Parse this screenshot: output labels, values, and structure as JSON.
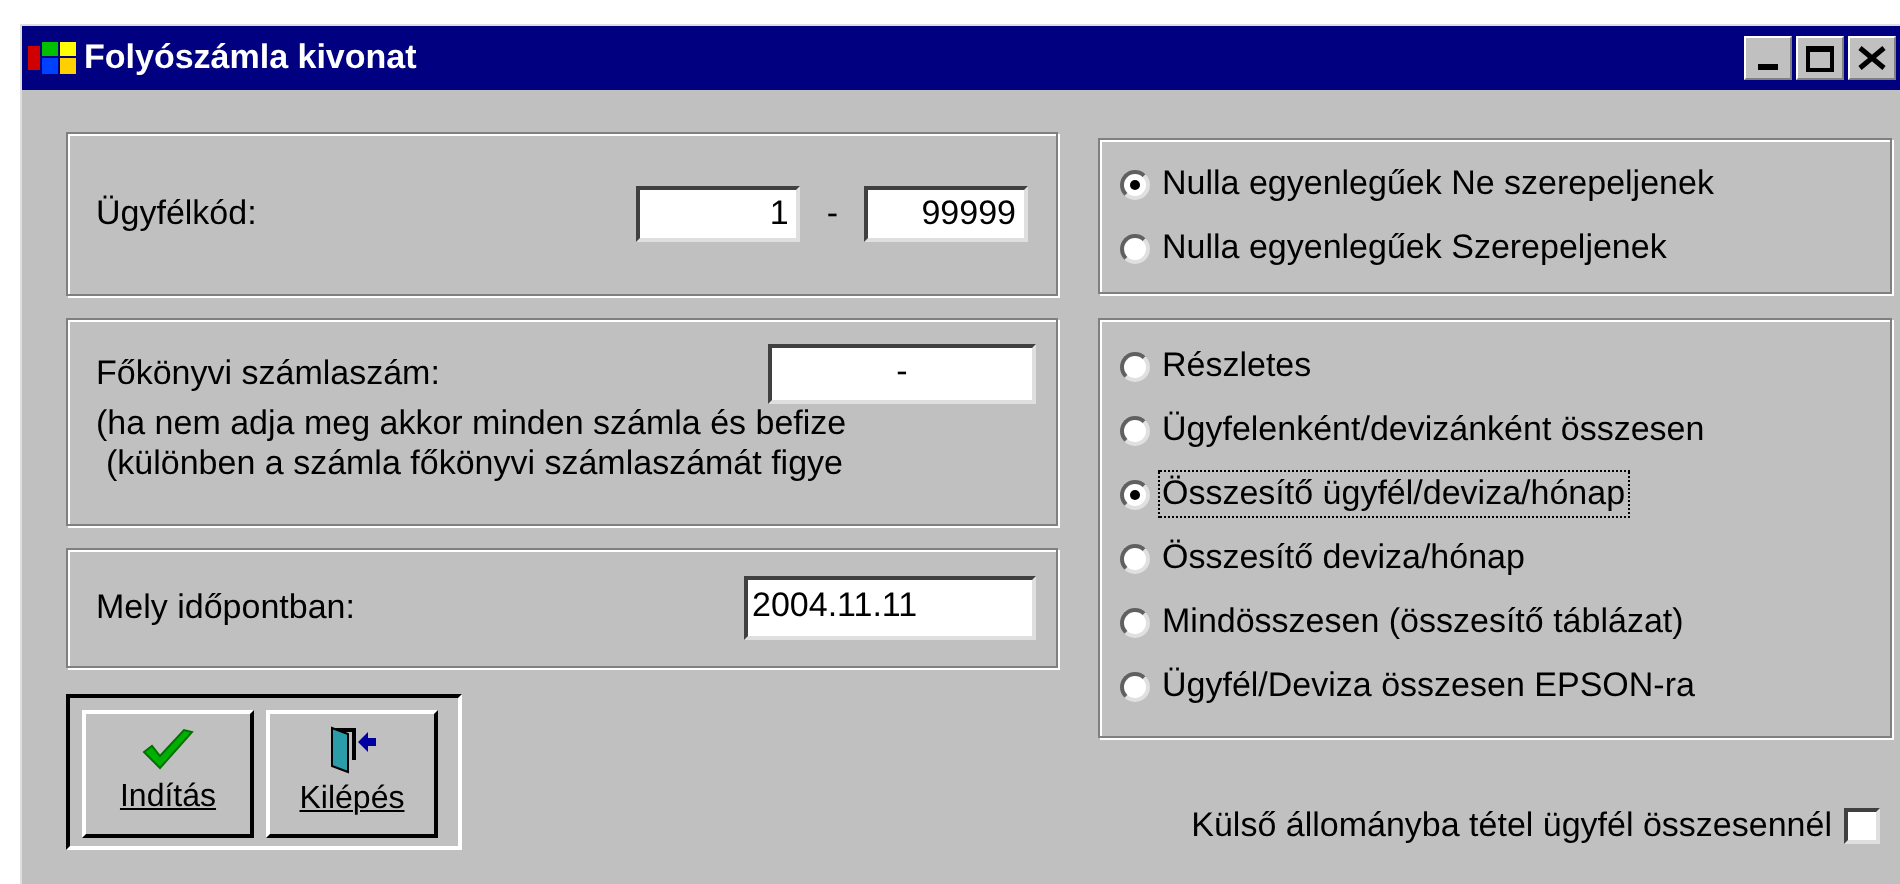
{
  "window": {
    "title": "Folyószámla kivonat"
  },
  "client_code": {
    "label": "Ügyfélkód:",
    "from": "1",
    "separator": "-",
    "to": "99999"
  },
  "ledger": {
    "label": "Főkönyvi számlaszám:",
    "value": "-",
    "notes": [
      "(ha nem adja meg akkor minden számla és befize",
      "(különben a számla főkönyvi számlaszámát figye"
    ]
  },
  "date": {
    "label": "Mely időpontban:",
    "value": "2004.11.11"
  },
  "buttons": [
    {
      "label": "Indítás",
      "kind": "start"
    },
    {
      "label": "Kilépés",
      "kind": "exit"
    }
  ],
  "zero_balance": [
    {
      "label": "Nulla egyenlegűek Ne szerepeljenek",
      "selected": true
    },
    {
      "label": "Nulla egyenlegűek Szerepeljenek",
      "selected": false
    }
  ],
  "report_type": [
    {
      "label": "Részletes",
      "selected": false,
      "focused": false
    },
    {
      "label": "Ügyfelenként/devizánként összesen",
      "selected": false,
      "focused": false
    },
    {
      "label": "Összesítő ügyfél/deviza/hónap",
      "selected": true,
      "focused": true
    },
    {
      "label": "Összesítő deviza/hónap",
      "selected": false,
      "focused": false
    },
    {
      "label": "Mindösszesen (összesítő táblázat)",
      "selected": false,
      "focused": false
    },
    {
      "label": "Ügyfél/Deviza összesen EPSON-ra",
      "selected": false,
      "focused": false
    }
  ],
  "export": {
    "label": "Külső állományba tétel ügyfél összesennél",
    "checked": false
  }
}
